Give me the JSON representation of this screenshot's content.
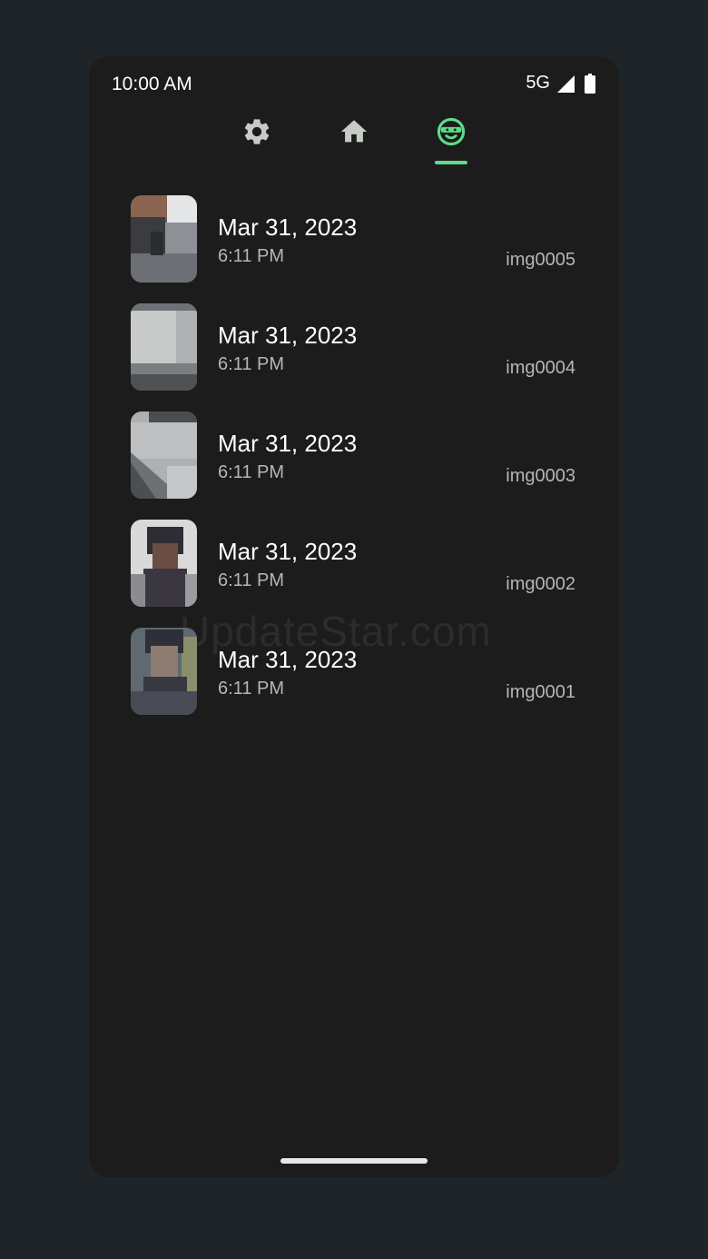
{
  "status_bar": {
    "time": "10:00 AM",
    "network": "5G",
    "icons": [
      "signal-icon",
      "battery-icon"
    ]
  },
  "nav": {
    "tabs": [
      {
        "icon": "settings-gear-icon",
        "selected": false
      },
      {
        "icon": "home-icon",
        "selected": false
      },
      {
        "icon": "intruder-mask-face-icon",
        "selected": true
      }
    ],
    "inactive_color": "#c7cbc6",
    "accent_color": "#5edb8b"
  },
  "records": [
    {
      "date": "Mar 31, 2023",
      "time": "6:11 PM",
      "file": "img0005",
      "thumbnail": "pixelated-photo-thumbnail"
    },
    {
      "date": "Mar 31, 2023",
      "time": "6:11 PM",
      "file": "img0004",
      "thumbnail": "pixelated-photo-thumbnail"
    },
    {
      "date": "Mar 31, 2023",
      "time": "6:11 PM",
      "file": "img0003",
      "thumbnail": "pixelated-photo-thumbnail"
    },
    {
      "date": "Mar 31, 2023",
      "time": "6:11 PM",
      "file": "img0002",
      "thumbnail": "pixelated-photo-thumbnail"
    },
    {
      "date": "Mar 31, 2023",
      "time": "6:11 PM",
      "file": "img0001",
      "thumbnail": "pixelated-photo-thumbnail"
    }
  ],
  "watermark": "UpdateStar.com"
}
